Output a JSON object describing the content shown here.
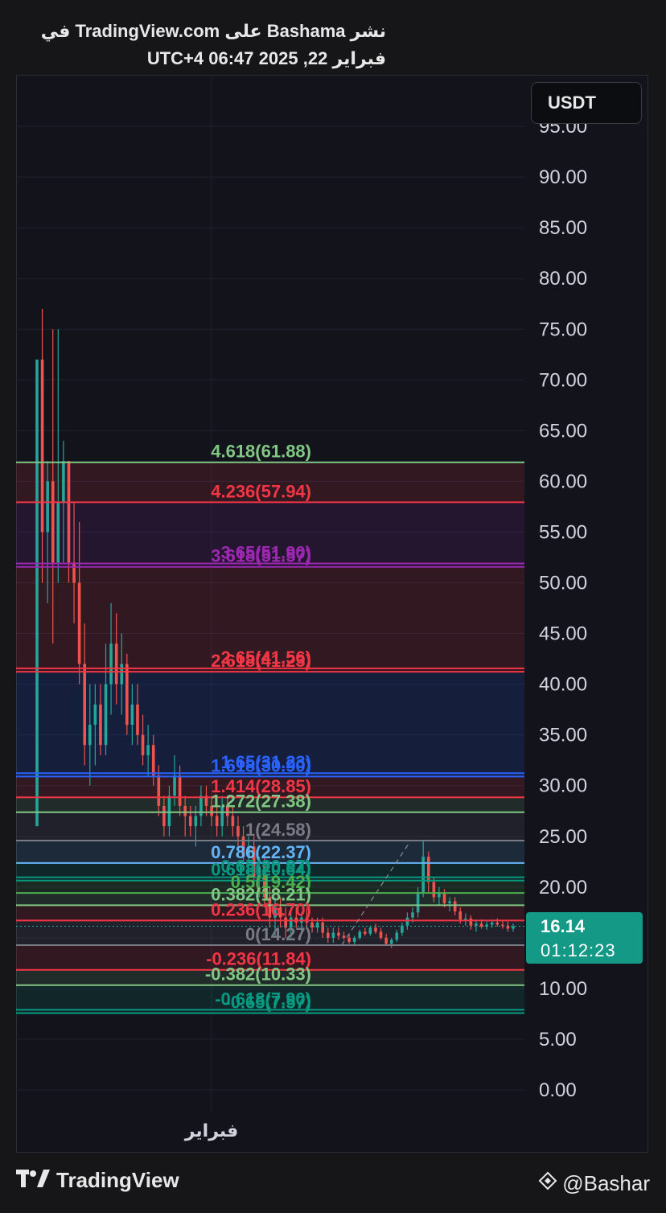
{
  "header": {
    "line1": "نشر Bashama على TradingView.com في",
    "line2": "فبراير 22, 2025 06:47 UTC+4"
  },
  "currency": "USDT",
  "price_tag": {
    "price": "16.14",
    "countdown": "01:12:23"
  },
  "footer": {
    "brand": "TradingView",
    "author": "@Bashar"
  },
  "colors": {
    "background": "#12131b",
    "up": "#26a69a",
    "down": "#ef5350",
    "price_tag": "#149987"
  },
  "chart_data": {
    "type": "candlestick",
    "y_axis": {
      "ticks": [
        0,
        5,
        10,
        15,
        20,
        25,
        30,
        35,
        40,
        45,
        50,
        55,
        60,
        65,
        70,
        75,
        80,
        85,
        90,
        95
      ],
      "tick_labels": [
        "0.00",
        "5.00",
        "10.00",
        "",
        "20.00",
        "25.00",
        "30.00",
        "35.00",
        "40.00",
        "45.00",
        "50.00",
        "55.00",
        "60.00",
        "65.00",
        "70.00",
        "75.00",
        "80.00",
        "85.00",
        "90.00",
        "95.00"
      ],
      "range": [
        0,
        95
      ]
    },
    "x_axis": {
      "labels": [
        {
          "text": "فبراير",
          "x": 0.384
        }
      ]
    },
    "last_price": 16.14,
    "fib_levels": [
      {
        "ratio": "4.618",
        "value": 61.88,
        "label": "4.618(61.88)",
        "color": "#81c784"
      },
      {
        "ratio": "4.236",
        "value": 57.94,
        "label": "4.236(57.94)",
        "color": "#f23645"
      },
      {
        "ratio": "3.65",
        "value": 51.9,
        "label": "3.65(51.90)",
        "color": "#9c27b0"
      },
      {
        "ratio": "3.618",
        "value": 51.57,
        "label": "3.618(51.57)",
        "color": "#9c27b0"
      },
      {
        "ratio": "2.65",
        "value": 41.56,
        "label": "2.65(41.56)",
        "color": "#f23645"
      },
      {
        "ratio": "2.618",
        "value": 41.23,
        "label": "2.618(41.23)",
        "color": "#f23645"
      },
      {
        "ratio": "1.65",
        "value": 31.23,
        "label": "1.65(31.23)",
        "color": "#2962ff"
      },
      {
        "ratio": "1.618",
        "value": 30.9,
        "label": "1.618(30.90)",
        "color": "#2962ff"
      },
      {
        "ratio": "1.414",
        "value": 28.85,
        "label": "1.414(28.85)",
        "color": "#f23645"
      },
      {
        "ratio": "1.272",
        "value": 27.38,
        "label": "1.272(27.38)",
        "color": "#81c784"
      },
      {
        "ratio": "1",
        "value": 24.58,
        "label": "1(24.58)",
        "color": "#787b86"
      },
      {
        "ratio": "0.786",
        "value": 22.37,
        "label": "0.786(22.37)",
        "color": "#64b5f6"
      },
      {
        "ratio": "0.65",
        "value": 20.97,
        "label": "0.65(20.97)",
        "color": "#089981"
      },
      {
        "ratio": "0.618",
        "value": 20.64,
        "label": "0.618(20.64)",
        "color": "#089981"
      },
      {
        "ratio": "0.5",
        "value": 19.42,
        "label": "0.5(19.42)",
        "color": "#4caf50"
      },
      {
        "ratio": "0.382",
        "value": 18.21,
        "label": "0.382(18.21)",
        "color": "#81c784"
      },
      {
        "ratio": "0.236",
        "value": 16.7,
        "label": "0.236(16.70)",
        "color": "#f23645"
      },
      {
        "ratio": "0",
        "value": 14.27,
        "label": "0(14.27)",
        "color": "#787b86"
      },
      {
        "ratio": "-0.236",
        "value": 11.84,
        "label": "-0.236(11.84)",
        "color": "#f23645"
      },
      {
        "ratio": "-0.382",
        "value": 10.33,
        "label": "-0.382(10.33)",
        "color": "#81c784"
      },
      {
        "ratio": "-0.618",
        "value": 7.9,
        "label": "-0.618(7.90)",
        "color": "#089981"
      },
      {
        "ratio": "-0.65",
        "value": 7.57,
        "label": "-0.65(7.57)",
        "color": "#089981"
      }
    ],
    "candles": [
      [
        0,
        26,
        72,
        26,
        72
      ],
      [
        1,
        72,
        77,
        50,
        55
      ],
      [
        2,
        55,
        62,
        48,
        60
      ],
      [
        3,
        60,
        75,
        44,
        52
      ],
      [
        4,
        52,
        75,
        50,
        58
      ],
      [
        5,
        58,
        64,
        52,
        62
      ],
      [
        6,
        62,
        62,
        50,
        52
      ],
      [
        7,
        52,
        58,
        46,
        50
      ],
      [
        8,
        50,
        56,
        40,
        42
      ],
      [
        9,
        42,
        46,
        32,
        34
      ],
      [
        10,
        34,
        40,
        30,
        36
      ],
      [
        11,
        36,
        40,
        32,
        38
      ],
      [
        12,
        38,
        40,
        33,
        34
      ],
      [
        13,
        34,
        44,
        33,
        40
      ],
      [
        14,
        40,
        48,
        37,
        44
      ],
      [
        15,
        44,
        47,
        38,
        40
      ],
      [
        16,
        40,
        45,
        37,
        42
      ],
      [
        17,
        42,
        43,
        35,
        36
      ],
      [
        18,
        36,
        40,
        34,
        38
      ],
      [
        19,
        38,
        40,
        34,
        35
      ],
      [
        20,
        35,
        37,
        32,
        33
      ],
      [
        21,
        33,
        36,
        31,
        34
      ],
      [
        22,
        34,
        35,
        30,
        31
      ],
      [
        23,
        31,
        32,
        27,
        28
      ],
      [
        24,
        28,
        29,
        25,
        26
      ],
      [
        25,
        26,
        30,
        25,
        29
      ],
      [
        26,
        29,
        33,
        28,
        31
      ],
      [
        27,
        31,
        32,
        27,
        28
      ],
      [
        28,
        28,
        29,
        25,
        27
      ],
      [
        29,
        27,
        28,
        25,
        26
      ],
      [
        30,
        26,
        28,
        24,
        27
      ],
      [
        31,
        27,
        30,
        26,
        29
      ],
      [
        32,
        29,
        30,
        27,
        28
      ],
      [
        33,
        28,
        29,
        26,
        27
      ],
      [
        34,
        27,
        28,
        25,
        26
      ],
      [
        35,
        26,
        29,
        25,
        28
      ],
      [
        36,
        28,
        29,
        26,
        27
      ],
      [
        37,
        27,
        28,
        25,
        26
      ],
      [
        38,
        26,
        27,
        24,
        25
      ],
      [
        39,
        25,
        26,
        22,
        23
      ],
      [
        40,
        23,
        25,
        21,
        24
      ],
      [
        41,
        24,
        25,
        20,
        21
      ],
      [
        42,
        21,
        23,
        19,
        22
      ],
      [
        43,
        22,
        23,
        18,
        19
      ],
      [
        44,
        19,
        20,
        16,
        17
      ],
      [
        45,
        17,
        19,
        15,
        18
      ],
      [
        46,
        18,
        19,
        16,
        17
      ],
      [
        47,
        17,
        18,
        15,
        16
      ],
      [
        48,
        16,
        18,
        15,
        17
      ],
      [
        49,
        17,
        18,
        16,
        16.5
      ],
      [
        50,
        16.5,
        17.5,
        15.5,
        17
      ],
      [
        51,
        17,
        18,
        16,
        16.5
      ],
      [
        52,
        16.5,
        17,
        15.5,
        16
      ],
      [
        53,
        16,
        17,
        15.5,
        16.5
      ],
      [
        54,
        16.5,
        17,
        15,
        15.5
      ],
      [
        55,
        15.5,
        16,
        14.5,
        15
      ],
      [
        56,
        15,
        16,
        14.5,
        15.5
      ],
      [
        57,
        15.5,
        16,
        14.8,
        15.2
      ],
      [
        58,
        15.2,
        15.6,
        14.8,
        15
      ],
      [
        59,
        15,
        15.4,
        14.4,
        14.6
      ],
      [
        60,
        14.6,
        15.2,
        14.3,
        15
      ],
      [
        61,
        15,
        15.8,
        14.8,
        15.6
      ],
      [
        62,
        15.6,
        16,
        15.2,
        15.4
      ],
      [
        63,
        15.4,
        16.2,
        15.2,
        16
      ],
      [
        64,
        16,
        16.4,
        15.4,
        15.6
      ],
      [
        65,
        15.6,
        16,
        14.8,
        15
      ],
      [
        66,
        15,
        15.4,
        14.2,
        14.4
      ],
      [
        67,
        14.4,
        15,
        14,
        14.8
      ],
      [
        68,
        14.8,
        15.8,
        14.6,
        15.5
      ],
      [
        69,
        15.5,
        16.5,
        15.2,
        16.2
      ],
      [
        70,
        16.2,
        17.5,
        15.8,
        17
      ],
      [
        71,
        17,
        18,
        16.5,
        17.5
      ],
      [
        72,
        17.5,
        20,
        17,
        19.5
      ],
      [
        73,
        19.5,
        24.5,
        19,
        23
      ],
      [
        74,
        23,
        23.5,
        19.5,
        20.5
      ],
      [
        75,
        20.5,
        21,
        18.5,
        19
      ],
      [
        76,
        19,
        20,
        18.2,
        19.4
      ],
      [
        77,
        19.4,
        19.8,
        18,
        18.4
      ],
      [
        78,
        18.4,
        19,
        17.6,
        18.6
      ],
      [
        79,
        18.6,
        19,
        17.2,
        17.6
      ],
      [
        80,
        17.6,
        18,
        16.4,
        16.8
      ],
      [
        81,
        16.8,
        17.4,
        16.2,
        16.9
      ],
      [
        82,
        16.9,
        17.2,
        15.8,
        16.2
      ],
      [
        83,
        16.2,
        16.8,
        15.6,
        16.4
      ],
      [
        84,
        16.4,
        16.8,
        15.9,
        16.1
      ],
      [
        85,
        16.1,
        16.6,
        15.8,
        16.3
      ],
      [
        86,
        16.3,
        16.8,
        16,
        16.5
      ],
      [
        87,
        16.5,
        16.9,
        16.1,
        16.3
      ],
      [
        88,
        16.3,
        16.7,
        15.9,
        16.2
      ],
      [
        89,
        16.2,
        16.6,
        15.6,
        15.9
      ],
      [
        90,
        15.9,
        16.4,
        15.6,
        16.14
      ]
    ]
  }
}
